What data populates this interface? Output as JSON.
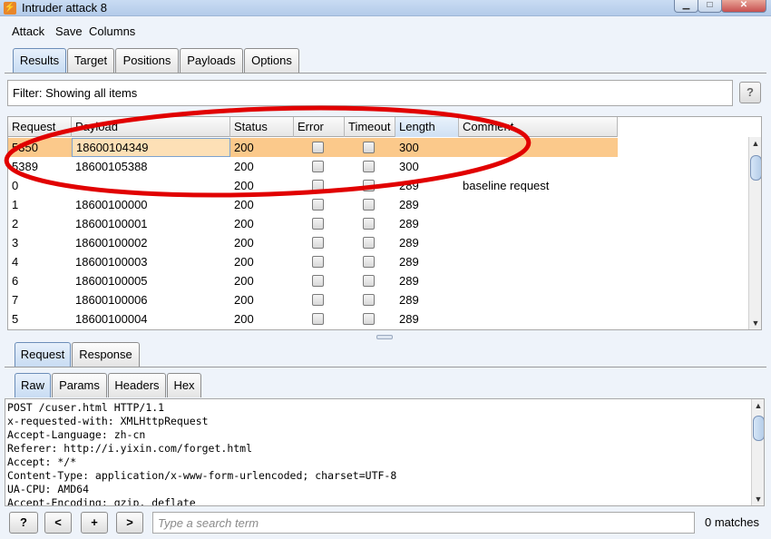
{
  "window": {
    "title": "Intruder attack 8",
    "app_icon_glyph": "⚡",
    "min_glyph": "▁",
    "max_glyph": "□",
    "close_glyph": "✕"
  },
  "menu": [
    "Attack",
    "Save",
    "Columns"
  ],
  "main_tabs": [
    "Results",
    "Target",
    "Positions",
    "Payloads",
    "Options"
  ],
  "filter": {
    "text": "Filter: Showing all items",
    "help_label": "?"
  },
  "table": {
    "columns": [
      "Request",
      "Payload",
      "Status",
      "Error",
      "Timeout",
      "Length",
      "Comment"
    ],
    "sorted_column": "Length",
    "rows": [
      {
        "request": "5350",
        "payload": "18600104349",
        "status": "200",
        "error": false,
        "timeout": false,
        "length": "300",
        "comment": "",
        "selected": true
      },
      {
        "request": "5389",
        "payload": "18600105388",
        "status": "200",
        "error": false,
        "timeout": false,
        "length": "300",
        "comment": ""
      },
      {
        "request": "0",
        "payload": "",
        "status": "200",
        "error": false,
        "timeout": false,
        "length": "289",
        "comment": "baseline request"
      },
      {
        "request": "1",
        "payload": "18600100000",
        "status": "200",
        "error": false,
        "timeout": false,
        "length": "289",
        "comment": ""
      },
      {
        "request": "2",
        "payload": "18600100001",
        "status": "200",
        "error": false,
        "timeout": false,
        "length": "289",
        "comment": ""
      },
      {
        "request": "3",
        "payload": "18600100002",
        "status": "200",
        "error": false,
        "timeout": false,
        "length": "289",
        "comment": ""
      },
      {
        "request": "4",
        "payload": "18600100003",
        "status": "200",
        "error": false,
        "timeout": false,
        "length": "289",
        "comment": ""
      },
      {
        "request": "6",
        "payload": "18600100005",
        "status": "200",
        "error": false,
        "timeout": false,
        "length": "289",
        "comment": ""
      },
      {
        "request": "7",
        "payload": "18600100006",
        "status": "200",
        "error": false,
        "timeout": false,
        "length": "289",
        "comment": ""
      },
      {
        "request": "5",
        "payload": "18600100004",
        "status": "200",
        "error": false,
        "timeout": false,
        "length": "289",
        "comment": ""
      }
    ]
  },
  "detail_tabs": [
    "Request",
    "Response"
  ],
  "view_tabs": [
    "Raw",
    "Params",
    "Headers",
    "Hex"
  ],
  "raw_request": [
    "POST /cuser.html HTTP/1.1",
    "x-requested-with: XMLHttpRequest",
    "Accept-Language: zh-cn",
    "Referer: http://i.yixin.com/forget.html",
    "Accept: */*",
    "Content-Type: application/x-www-form-urlencoded; charset=UTF-8",
    "UA-CPU: AMD64",
    "Accept-Encoding: gzip, deflate"
  ],
  "bottom_bar": {
    "help_label": "?",
    "prev_label": "<",
    "add_label": "+",
    "next_label": ">",
    "search_placeholder": "Type a search term",
    "matches": "0 matches"
  },
  "colors": {
    "selected_row": "#fbc98b",
    "annotation": "#e10000",
    "active_tab": "#c8dcf3"
  },
  "icons": [
    "app-icon",
    "minimize-icon",
    "maximize-icon",
    "close-icon",
    "scroll-up-icon",
    "scroll-down-icon"
  ]
}
